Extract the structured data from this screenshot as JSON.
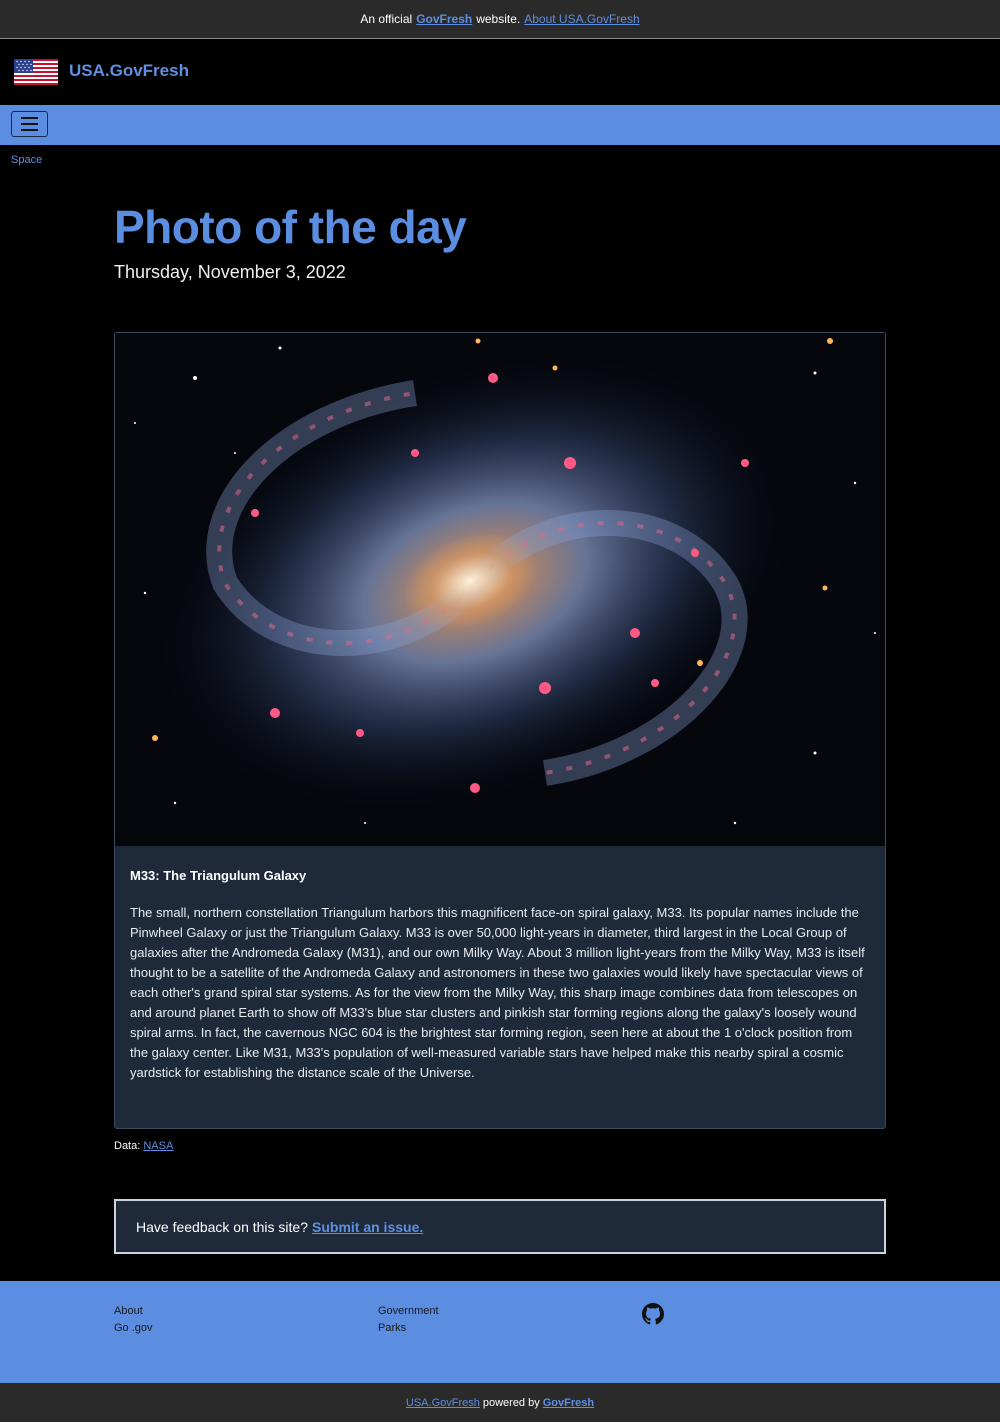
{
  "banner": {
    "prefix": "An official",
    "brand": "GovFresh",
    "middle": "website.",
    "about_link": "About USA.GovFresh"
  },
  "header": {
    "site_title": "USA.GovFresh",
    "flag_icon": "us-flag-icon"
  },
  "nav": {
    "menu_icon": "hamburger-menu-icon",
    "breadcrumb": "Space"
  },
  "main": {
    "title": "Photo of the day",
    "date": "Thursday, November 3, 2022"
  },
  "photo": {
    "title": "M33: The Triangulum Galaxy",
    "description": "The small, northern constellation Triangulum harbors this magnificent face-on spiral galaxy, M33. Its popular names include the Pinwheel Galaxy or just the Triangulum Galaxy. M33 is over 50,000 light-years in diameter, third largest in the Local Group of galaxies after the Andromeda Galaxy (M31), and our own Milky Way. About 3 million light-years from the Milky Way, M33 is itself thought to be a satellite of the Andromeda Galaxy and astronomers in these two galaxies would likely have spectacular views of each other's grand spiral star systems. As for the view from the Milky Way, this sharp image combines data from telescopes on and around planet Earth to show off M33's blue star clusters and pinkish star forming regions along the galaxy's loosely wound spiral arms. In fact, the cavernous NGC 604 is the brightest star forming region, seen here at about the 1 o'clock position from the galaxy center. Like M31, M33's population of well-measured variable stars have helped make this nearby spiral a cosmic yardstick for establishing the distance scale of the Universe."
  },
  "credit": {
    "label": "Data:",
    "source": "NASA"
  },
  "feedback": {
    "text": "Have feedback on this site?",
    "link": "Submit an issue."
  },
  "footer": {
    "col1": [
      "About",
      "Go .gov"
    ],
    "col2": [
      "Government",
      "Parks"
    ],
    "github_icon": "github-icon",
    "bottom_site": "USA.GovFresh",
    "bottom_middle": "powered by",
    "bottom_brand": "GovFresh"
  },
  "colors": {
    "accent": "#5b8de0",
    "background": "#000000",
    "card": "#1e2a3a",
    "banner": "#2a2a2a"
  }
}
